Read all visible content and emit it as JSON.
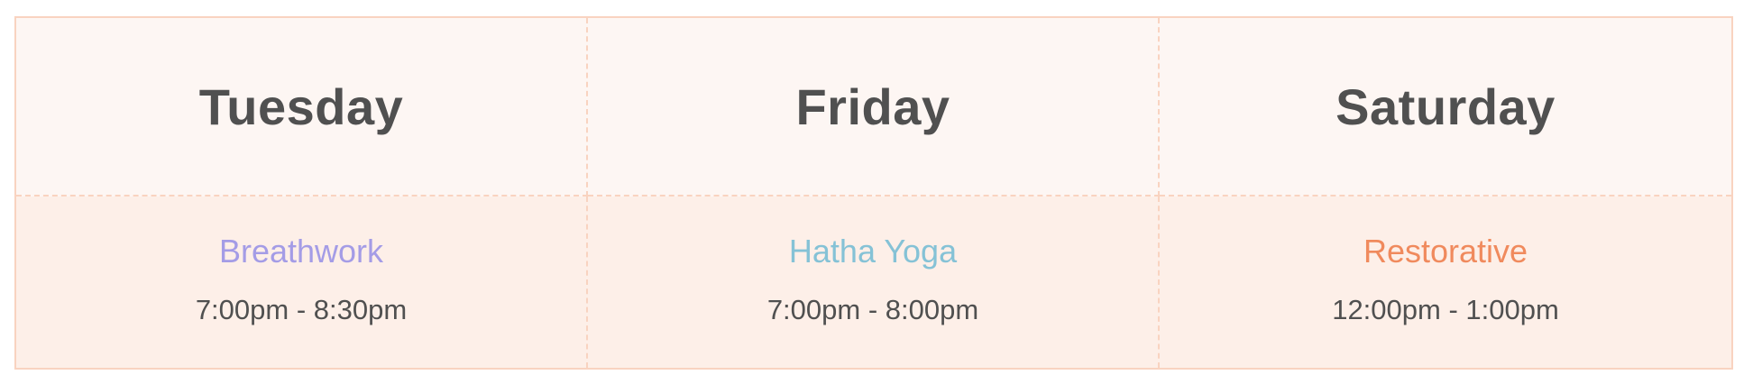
{
  "colors": {
    "border": "#f9d3c0",
    "header_bg": "#fdf6f3",
    "body_bg": "#fdefe8",
    "text": "#505050"
  },
  "schedule": {
    "days": [
      {
        "day": "Tuesday",
        "class_name": "Breathwork",
        "class_color": "#a49ce6",
        "time": "7:00pm - 8:30pm"
      },
      {
        "day": "Friday",
        "class_name": "Hatha Yoga",
        "class_color": "#85c2d6",
        "time": "7:00pm - 8:00pm"
      },
      {
        "day": "Saturday",
        "class_name": "Restorative",
        "class_color": "#f08a5d",
        "time": "12:00pm - 1:00pm"
      }
    ]
  }
}
